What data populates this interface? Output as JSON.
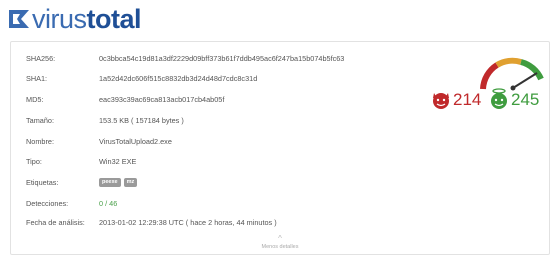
{
  "brand": {
    "part1": "virus",
    "part2": "total"
  },
  "fields": [
    {
      "label": "SHA256:",
      "value": "0c3bbca54c19d81a3df2229d09bff373b61f7ddb495ac6f247ba15b074b5fc63"
    },
    {
      "label": "SHA1:",
      "value": "1a52d42dc606f515c8832db3d24d48d7cdc8c31d"
    },
    {
      "label": "MD5:",
      "value": "eac393c39ac69ca813acb017cb4ab05f"
    },
    {
      "label": "Tamaño:",
      "value": "153.5 KB ( 157184 bytes )"
    },
    {
      "label": "Nombre:",
      "value": "VirusTotalUpload2.exe"
    },
    {
      "label": "Tipo:",
      "value": "Win32 EXE"
    },
    {
      "label": "Etiquetas:",
      "tags": [
        "peexe",
        "mz"
      ]
    },
    {
      "label": "Detecciones:",
      "value": "0 / 46"
    },
    {
      "label": "Fecha de análisis:",
      "value": "2013-01-02 12:29:38 UTC ( hace 2 horas, 44 minutos )"
    }
  ],
  "score": {
    "bad_count": "214",
    "good_count": "245",
    "colors": {
      "bad": "#c0292b",
      "good": "#3f9c3f",
      "gauge_needle": "#333333"
    },
    "icons": {
      "bad": "devil-face-icon",
      "good": "angel-face-icon",
      "gauge": "gauge-icon"
    }
  },
  "footer": {
    "caret": "^",
    "link": "Menos detalles"
  }
}
